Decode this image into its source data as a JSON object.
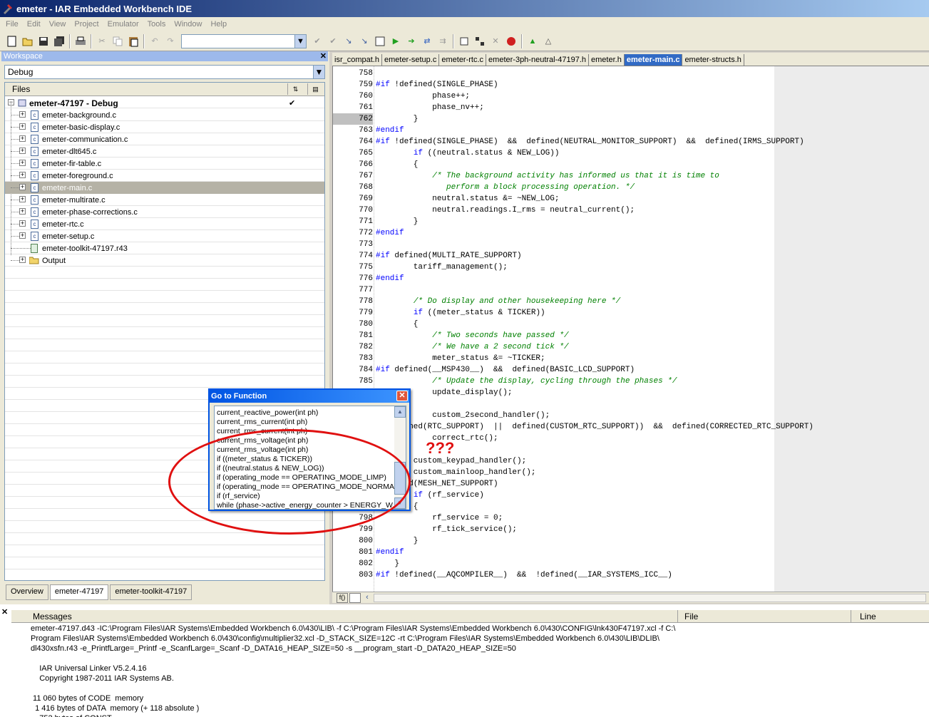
{
  "window": {
    "title": "emeter - IAR Embedded Workbench IDE"
  },
  "menu": [
    "File",
    "Edit",
    "View",
    "Project",
    "Emulator",
    "Tools",
    "Window",
    "Help"
  ],
  "workspace": {
    "header": "Workspace",
    "configuration": "Debug",
    "files_header": "Files",
    "project": "emeter-47197 - Debug",
    "files": [
      "emeter-background.c",
      "emeter-basic-display.c",
      "emeter-communication.c",
      "emeter-dlt645.c",
      "emeter-fir-table.c",
      "emeter-foreground.c",
      "emeter-main.c",
      "emeter-multirate.c",
      "emeter-phase-corrections.c",
      "emeter-rtc.c",
      "emeter-setup.c",
      "emeter-toolkit-47197.r43",
      "Output"
    ],
    "tabs": [
      "Overview",
      "emeter-47197",
      "emeter-toolkit-47197"
    ]
  },
  "editor": {
    "tabs": [
      "isr_compat.h",
      "emeter-setup.c",
      "emeter-rtc.c",
      "emeter-3ph-neutral-47197.h",
      "emeter.h",
      "emeter-main.c",
      "emeter-structs.h"
    ],
    "active_tab": "emeter-main.c",
    "lines": [
      {
        "n": "758",
        "t": ""
      },
      {
        "n": "759",
        "t": "#if !defined(SINGLE_PHASE)"
      },
      {
        "n": "760",
        "t": "            phase++;"
      },
      {
        "n": "761",
        "t": "            phase_nv++;"
      },
      {
        "n": "762",
        "t": "        }"
      },
      {
        "n": "763",
        "t": "#endif"
      },
      {
        "n": "764",
        "t": "#if !defined(SINGLE_PHASE)  &&  defined(NEUTRAL_MONITOR_SUPPORT)  &&  defined(IRMS_SUPPORT)"
      },
      {
        "n": "765",
        "t": "        if ((neutral.status & NEW_LOG))"
      },
      {
        "n": "766",
        "t": "        {"
      },
      {
        "n": "767",
        "t": "            /* The background activity has informed us that it is time to"
      },
      {
        "n": "768",
        "t": "               perform a block processing operation. */"
      },
      {
        "n": "769",
        "t": "            neutral.status &= ~NEW_LOG;"
      },
      {
        "n": "770",
        "t": "            neutral.readings.I_rms = neutral_current();"
      },
      {
        "n": "771",
        "t": "        }"
      },
      {
        "n": "772",
        "t": "#endif"
      },
      {
        "n": "773",
        "t": ""
      },
      {
        "n": "774",
        "t": "#if defined(MULTI_RATE_SUPPORT)"
      },
      {
        "n": "775",
        "t": "        tariff_management();"
      },
      {
        "n": "776",
        "t": "#endif"
      },
      {
        "n": "777",
        "t": ""
      },
      {
        "n": "778",
        "t": "        /* Do display and other housekeeping here */"
      },
      {
        "n": "779",
        "t": "        if ((meter_status & TICKER))"
      },
      {
        "n": "780",
        "t": "        {"
      },
      {
        "n": "781",
        "t": "            /* Two seconds have passed */"
      },
      {
        "n": "782",
        "t": "            /* We have a 2 second tick */"
      },
      {
        "n": "783",
        "t": "            meter_status &= ~TICKER;"
      },
      {
        "n": "784",
        "t": "#if defined(__MSP430__)  &&  defined(BASIC_LCD_SUPPORT)"
      },
      {
        "n": "785",
        "t": "            /* Update the display, cycling through the phases */"
      },
      {
        "n": "",
        "t": "            update_display();"
      },
      {
        "n": "",
        "t": ""
      },
      {
        "n": "",
        "t": "            custom_2second_handler();"
      },
      {
        "n": "",
        "t": "     fined(RTC_SUPPORT)  ||  defined(CUSTOM_RTC_SUPPORT))  &&  defined(CORRECTED_RTC_SUPPORT)"
      },
      {
        "n": "",
        "t": "            correct_rtc();"
      },
      {
        "n": "",
        "t": ""
      },
      {
        "n": "",
        "t": "        custom_keypad_handler();"
      },
      {
        "n": "",
        "t": "        custom_mainloop_handler();"
      },
      {
        "n": "",
        "t": "     ned(MESH_NET_SUPPORT)"
      },
      {
        "n": "",
        "t": "        if (rf_service)"
      },
      {
        "n": "797",
        "t": "        {"
      },
      {
        "n": "798",
        "t": "            rf_service = 0;"
      },
      {
        "n": "799",
        "t": "            rf_tick_service();"
      },
      {
        "n": "800",
        "t": "        }"
      },
      {
        "n": "801",
        "t": "#endif"
      },
      {
        "n": "802",
        "t": "    }"
      },
      {
        "n": "803",
        "t": "#if !defined(__AQCOMPILER__)  &&  !defined(__IAR_SYSTEMS_ICC__)"
      }
    ],
    "highlighted_line": "762"
  },
  "dialog": {
    "title": "Go to Function",
    "items": [
      "current_reactive_power(int ph)",
      "current_rms_current(int ph)",
      "current_rms_current(int ph)",
      "current_rms_voltage(int ph)",
      "current_rms_voltage(int ph)",
      "if ((meter_status & TICKER))",
      "if ((neutral.status & NEW_LOG))",
      "if (operating_mode == OPERATING_MODE_LIMP)",
      "if (operating_mode == OPERATING_MODE_NORMA",
      "if (rf_service)",
      "while (phase->active_energy_counter > ENERGY_W..."
    ]
  },
  "annotation": {
    "text": "???",
    "color": "#e01010"
  },
  "messages": {
    "columns": [
      "Messages",
      "File",
      "Line"
    ],
    "lines": [
      "emeter-47197.d43 -IC:\\Program Files\\IAR Systems\\Embedded Workbench 6.0\\430\\LIB\\ -f C:\\Program Files\\IAR Systems\\Embedded Workbench 6.0\\430\\CONFIG\\lnk430F47197.xcl -f C:\\",
      "Program Files\\IAR Systems\\Embedded Workbench 6.0\\430\\config\\multiplier32.xcl -D_STACK_SIZE=12C -rt C:\\Program Files\\IAR Systems\\Embedded Workbench 6.0\\430\\LIB\\DLIB\\",
      "dl430xsfn.r43 -e_PrintfLarge=_Printf -e_ScanfLarge=_Scanf -D_DATA16_HEAP_SIZE=50 -s __program_start -D_DATA20_HEAP_SIZE=50",
      "",
      "    IAR Universal Linker V5.2.4.16",
      "    Copyright 1987-2011 IAR Systems AB.",
      "",
      " 11 060 bytes of CODE  memory",
      "  1 416 bytes of DATA  memory (+ 118 absolute )",
      "    752 bytes of CONST"
    ]
  }
}
